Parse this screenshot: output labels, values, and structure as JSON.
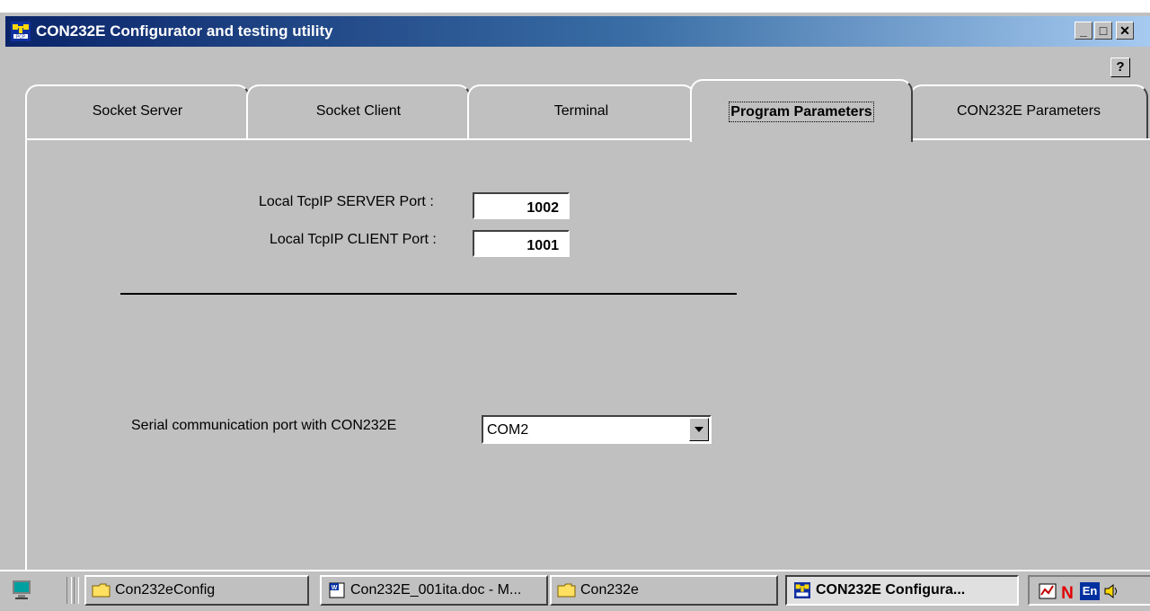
{
  "window": {
    "title": "CON232E Configurator and testing utility",
    "minimize_glyph": "_",
    "maximize_glyph": "□",
    "close_glyph": "✕",
    "help_glyph": "?"
  },
  "tabs": [
    {
      "label": "Socket Server",
      "active": false
    },
    {
      "label": "Socket Client",
      "active": false
    },
    {
      "label": "Terminal",
      "active": false
    },
    {
      "label": "Program Parameters",
      "active": true
    },
    {
      "label": "CON232E Parameters",
      "active": false
    }
  ],
  "program_parameters": {
    "server_port_label": "Local TcpIP SERVER Port :",
    "server_port_value": "1002",
    "client_port_label": "Local TcpIP CLIENT Port :",
    "client_port_value": "1001",
    "serial_port_label": "Serial communication port with CON232E",
    "serial_port_value": "COM2"
  },
  "taskbar": {
    "buttons": [
      {
        "label": "Con232eConfig",
        "icon": "folder-icon"
      },
      {
        "label": "Con232E_001ita.doc - M...",
        "icon": "word-document-icon"
      },
      {
        "label": "Con232e",
        "icon": "folder-icon"
      },
      {
        "label": "CON232E Configura...",
        "icon": "app-icon",
        "active": true
      }
    ],
    "tray": {
      "language": "En"
    }
  },
  "colors": {
    "face": "#c0c0c0",
    "title_start": "#0a246a",
    "title_end": "#a6caf0"
  }
}
